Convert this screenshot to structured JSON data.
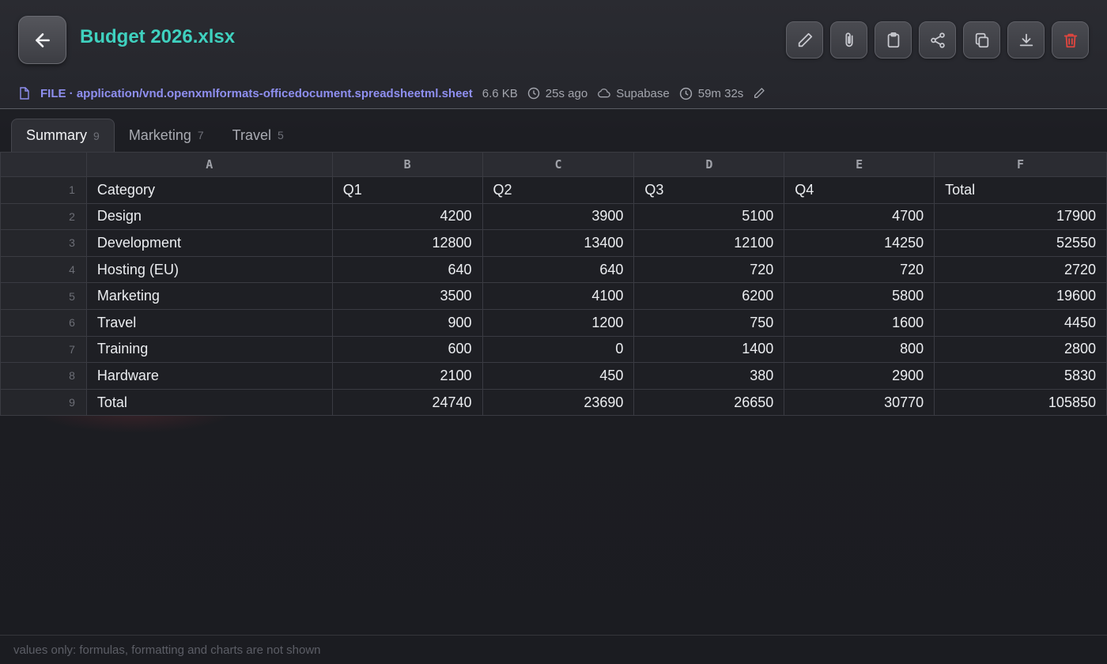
{
  "file": {
    "title": "Budget 2026.xlsx",
    "type_label": "FILE · application/vnd.openxmlformats-officedocument.spreadsheetml.sheet",
    "size": "6.6 KB",
    "modified": "25s ago",
    "storage": "Supabase",
    "duration": "59m 32s"
  },
  "toolbar": [
    "pencil-icon",
    "paperclip-icon",
    "clipboard-icon",
    "share-icon",
    "copy-icon",
    "download-icon",
    "trash-icon"
  ],
  "tabs": [
    {
      "label": "Summary",
      "count": "9",
      "active": true
    },
    {
      "label": "Marketing",
      "count": "7",
      "active": false
    },
    {
      "label": "Travel",
      "count": "5",
      "active": false
    }
  ],
  "grid": {
    "columns": [
      "A",
      "B",
      "C",
      "D",
      "E",
      "F"
    ],
    "rows": [
      {
        "n": "1",
        "cells": [
          "Category",
          "Q1",
          "Q2",
          "Q3",
          "Q4",
          "Total"
        ]
      },
      {
        "n": "2",
        "cells": [
          "Design",
          "4200",
          "3900",
          "5100",
          "4700",
          "17900"
        ]
      },
      {
        "n": "3",
        "cells": [
          "Development",
          "12800",
          "13400",
          "12100",
          "14250",
          "52550"
        ]
      },
      {
        "n": "4",
        "cells": [
          "Hosting (EU)",
          "640",
          "640",
          "720",
          "720",
          "2720"
        ]
      },
      {
        "n": "5",
        "cells": [
          "Marketing",
          "3500",
          "4100",
          "6200",
          "5800",
          "19600"
        ]
      },
      {
        "n": "6",
        "cells": [
          "Travel",
          "900",
          "1200",
          "750",
          "1600",
          "4450"
        ]
      },
      {
        "n": "7",
        "cells": [
          "Training",
          "600",
          "0",
          "1400",
          "800",
          "2800"
        ]
      },
      {
        "n": "8",
        "cells": [
          "Hardware",
          "2100",
          "450",
          "380",
          "2900",
          "5830"
        ]
      },
      {
        "n": "9",
        "cells": [
          "Total",
          "24740",
          "23690",
          "26650",
          "30770",
          "105850"
        ]
      }
    ]
  },
  "footer": {
    "note": "values only: formulas, formatting and charts are not shown"
  },
  "colors": {
    "accent": "#3fd1bf",
    "mime": "#8f8ff0",
    "danger": "#e0463f"
  }
}
